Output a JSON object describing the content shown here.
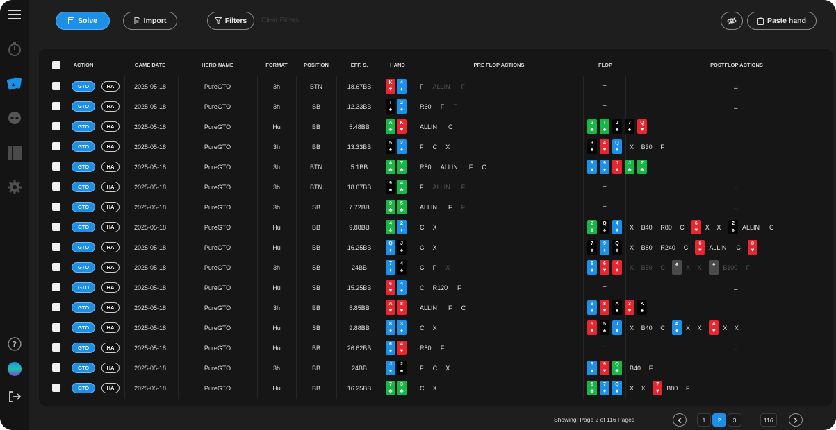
{
  "toolbar": {
    "solve_label": "Solve",
    "import_label": "Import",
    "filters_label": "Filters",
    "clear_filters_label": "Clear Filters",
    "paste_hand_label": "Paste hand"
  },
  "table": {
    "columns": [
      "ACTION",
      "GAME DATE",
      "HERO NAME",
      "FORMAT",
      "POSITION",
      "EFF. S.",
      "HAND",
      "PRE FLOP ACTIONS",
      "FLOP",
      "POSTFLOP ACTIONS"
    ],
    "gto_label": "GTO",
    "ha_label": "HA",
    "rows": [
      {
        "date": "2025-05-18",
        "hero": "PureGTO",
        "format": "3h",
        "position": "BTN",
        "eff": "18.67BB",
        "hand": [
          {
            "r": "K",
            "s": "♥",
            "c": "red"
          },
          {
            "r": "4",
            "s": "♦",
            "c": "blue"
          }
        ],
        "pre": [
          {
            "t": "F"
          },
          {
            "t": "ALLIN",
            "dim": true
          },
          {
            "t": "F",
            "dim": true
          }
        ],
        "flop": [],
        "post": []
      },
      {
        "date": "2025-05-18",
        "hero": "PureGTO",
        "format": "3h",
        "position": "SB",
        "eff": "12.33BB",
        "hand": [
          {
            "r": "T",
            "s": "♠",
            "c": "black"
          },
          {
            "r": "2",
            "s": "♦",
            "c": "blue"
          }
        ],
        "pre": [
          {
            "t": "R60"
          },
          {
            "t": "F"
          },
          {
            "t": "F",
            "dim": true
          }
        ],
        "flop": [],
        "post": []
      },
      {
        "date": "2025-05-18",
        "hero": "PureGTO",
        "format": "Hu",
        "position": "BB",
        "eff": "5.48BB",
        "hand": [
          {
            "r": "A",
            "s": "♣",
            "c": "green"
          },
          {
            "r": "K",
            "s": "♥",
            "c": "red"
          }
        ],
        "pre": [
          {
            "t": "ALLIN"
          },
          {
            "t": "C"
          }
        ],
        "flop": [
          {
            "r": "2",
            "s": "♣",
            "c": "green"
          },
          {
            "r": "T",
            "s": "♣",
            "c": "green"
          },
          {
            "r": "J",
            "s": "♠",
            "c": "black"
          },
          {
            "r": "7",
            "s": "♠",
            "c": "black"
          },
          {
            "r": "Q",
            "s": "♥",
            "c": "red"
          }
        ],
        "post": []
      },
      {
        "date": "2025-05-18",
        "hero": "PureGTO",
        "format": "3h",
        "position": "BB",
        "eff": "13.33BB",
        "hand": [
          {
            "r": "5",
            "s": "♠",
            "c": "black"
          },
          {
            "r": "2",
            "s": "♦",
            "c": "blue"
          }
        ],
        "pre": [
          {
            "t": "F"
          },
          {
            "t": "C"
          },
          {
            "t": "X"
          }
        ],
        "flop": [
          {
            "r": "3",
            "s": "♠",
            "c": "black"
          },
          {
            "r": "4",
            "s": "♥",
            "c": "red"
          },
          {
            "r": "Q",
            "s": "♦",
            "c": "blue"
          }
        ],
        "post": [
          {
            "t": "X"
          },
          {
            "t": "B30"
          },
          {
            "t": "F"
          }
        ]
      },
      {
        "date": "2025-05-18",
        "hero": "PureGTO",
        "format": "3h",
        "position": "BTN",
        "eff": "5.1BB",
        "hand": [
          {
            "r": "A",
            "s": "♣",
            "c": "green"
          },
          {
            "r": "T",
            "s": "♣",
            "c": "green"
          }
        ],
        "pre": [
          {
            "t": "R80"
          },
          {
            "t": "ALLIN"
          },
          {
            "t": "F"
          },
          {
            "t": "C"
          }
        ],
        "flop": [
          {
            "r": "3",
            "s": "♦",
            "c": "blue"
          },
          {
            "r": "9",
            "s": "♦",
            "c": "blue"
          },
          {
            "r": "J",
            "s": "♥",
            "c": "red"
          },
          {
            "r": "J",
            "s": "♣",
            "c": "green"
          },
          {
            "r": "7",
            "s": "♣",
            "c": "green"
          }
        ],
        "post": []
      },
      {
        "date": "2025-05-18",
        "hero": "PureGTO",
        "format": "3h",
        "position": "BTN",
        "eff": "18.67BB",
        "hand": [
          {
            "r": "9",
            "s": "♠",
            "c": "black"
          },
          {
            "r": "4",
            "s": "♣",
            "c": "green"
          }
        ],
        "pre": [
          {
            "t": "F"
          },
          {
            "t": "ALLIN",
            "dim": true
          },
          {
            "t": "F",
            "dim": true
          }
        ],
        "flop": [],
        "post": []
      },
      {
        "date": "2025-05-18",
        "hero": "PureGTO",
        "format": "3h",
        "position": "SB",
        "eff": "7.72BB",
        "hand": [
          {
            "r": "9",
            "s": "♣",
            "c": "green"
          },
          {
            "r": "5",
            "s": "♣",
            "c": "green"
          }
        ],
        "pre": [
          {
            "t": "ALLIN"
          },
          {
            "t": "F"
          },
          {
            "t": "F",
            "dim": true
          }
        ],
        "flop": [],
        "post": []
      },
      {
        "date": "2025-05-18",
        "hero": "PureGTO",
        "format": "Hu",
        "position": "BB",
        "eff": "9.88BB",
        "hand": [
          {
            "r": "4",
            "s": "♣",
            "c": "green"
          },
          {
            "r": "2",
            "s": "♦",
            "c": "blue"
          }
        ],
        "pre": [
          {
            "t": "C"
          },
          {
            "t": "X"
          }
        ],
        "flop": [
          {
            "r": "2",
            "s": "♣",
            "c": "green"
          },
          {
            "r": "Q",
            "s": "♠",
            "c": "black"
          },
          {
            "r": "4",
            "s": "♦",
            "c": "blue"
          }
        ],
        "post": [
          {
            "t": "X"
          },
          {
            "t": "B40"
          },
          {
            "t": "R80"
          },
          {
            "t": "C"
          },
          {
            "card": {
              "r": "6",
              "s": "♥",
              "c": "red"
            }
          },
          {
            "t": "X"
          },
          {
            "t": "X"
          },
          {
            "card": {
              "r": "2",
              "s": "♠",
              "c": "black"
            }
          },
          {
            "t": "ALLIN"
          },
          {
            "t": "C"
          }
        ]
      },
      {
        "date": "2025-05-18",
        "hero": "PureGTO",
        "format": "Hu",
        "position": "BB",
        "eff": "16.25BB",
        "hand": [
          {
            "r": "Q",
            "s": "♦",
            "c": "blue"
          },
          {
            "r": "J",
            "s": "♠",
            "c": "black"
          }
        ],
        "pre": [
          {
            "t": "C"
          },
          {
            "t": "X"
          }
        ],
        "flop": [
          {
            "r": "7",
            "s": "♠",
            "c": "black"
          },
          {
            "r": "9",
            "s": "♦",
            "c": "blue"
          },
          {
            "r": "Q",
            "s": "♠",
            "c": "black"
          }
        ],
        "post": [
          {
            "t": "X"
          },
          {
            "t": "B80"
          },
          {
            "t": "R240"
          },
          {
            "t": "C"
          },
          {
            "card": {
              "r": "6",
              "s": "♥",
              "c": "red"
            }
          },
          {
            "t": "ALLIN"
          },
          {
            "t": "C"
          },
          {
            "card": {
              "r": "8",
              "s": "♥",
              "c": "red"
            }
          }
        ]
      },
      {
        "date": "2025-05-18",
        "hero": "PureGTO",
        "format": "3h",
        "position": "SB",
        "eff": "24BB",
        "hand": [
          {
            "r": "7",
            "s": "♦",
            "c": "blue"
          },
          {
            "r": "4",
            "s": "♠",
            "c": "black"
          }
        ],
        "pre": [
          {
            "t": "C"
          },
          {
            "t": "F"
          },
          {
            "t": "X",
            "dim": true
          }
        ],
        "flop": [
          {
            "r": "6",
            "s": "♦",
            "c": "blue"
          },
          {
            "r": "6",
            "s": "♥",
            "c": "red"
          },
          {
            "r": "K",
            "s": "♥",
            "c": "red"
          }
        ],
        "post": [
          {
            "t": "X",
            "dim": true
          },
          {
            "t": "B50",
            "dim": true
          },
          {
            "t": "C",
            "dim": true
          },
          {
            "card": {
              "r": "",
              "s": "♠",
              "c": "gray"
            }
          },
          {
            "t": "X",
            "dim": true
          },
          {
            "t": "X",
            "dim": true
          },
          {
            "card": {
              "r": "",
              "s": "♠",
              "c": "gray"
            }
          },
          {
            "t": "B100",
            "dim": true
          },
          {
            "t": "F",
            "dim": true
          }
        ]
      },
      {
        "date": "2025-05-18",
        "hero": "PureGTO",
        "format": "Hu",
        "position": "SB",
        "eff": "15.25BB",
        "hand": [
          {
            "r": "6",
            "s": "♥",
            "c": "red"
          },
          {
            "r": "4",
            "s": "♦",
            "c": "blue"
          }
        ],
        "pre": [
          {
            "t": "C"
          },
          {
            "t": "R120"
          },
          {
            "t": "F"
          }
        ],
        "flop": [],
        "post": []
      },
      {
        "date": "2025-05-18",
        "hero": "PureGTO",
        "format": "3h",
        "position": "BB",
        "eff": "5.85BB",
        "hand": [
          {
            "r": "A",
            "s": "♥",
            "c": "red"
          },
          {
            "r": "8",
            "s": "♥",
            "c": "red"
          }
        ],
        "pre": [
          {
            "t": "ALLIN"
          },
          {
            "t": "F"
          },
          {
            "t": "C"
          }
        ],
        "flop": [
          {
            "r": "9",
            "s": "♦",
            "c": "blue"
          },
          {
            "r": "8",
            "s": "♥",
            "c": "red"
          },
          {
            "r": "A",
            "s": "♠",
            "c": "black"
          },
          {
            "r": "3",
            "s": "♥",
            "c": "red"
          },
          {
            "r": "K",
            "s": "♠",
            "c": "black"
          }
        ],
        "post": []
      },
      {
        "date": "2025-05-18",
        "hero": "PureGTO",
        "format": "Hu",
        "position": "SB",
        "eff": "9.88BB",
        "hand": [
          {
            "r": "8",
            "s": "♦",
            "c": "blue"
          },
          {
            "r": "3",
            "s": "♦",
            "c": "blue"
          }
        ],
        "pre": [
          {
            "t": "C"
          },
          {
            "t": "X"
          }
        ],
        "flop": [
          {
            "r": "5",
            "s": "♥",
            "c": "red"
          },
          {
            "r": "5",
            "s": "♠",
            "c": "black"
          },
          {
            "r": "J",
            "s": "♦",
            "c": "blue"
          }
        ],
        "post": [
          {
            "t": "X"
          },
          {
            "t": "B40"
          },
          {
            "t": "C"
          },
          {
            "card": {
              "r": "A",
              "s": "♦",
              "c": "blue"
            }
          },
          {
            "t": "X"
          },
          {
            "t": "X"
          },
          {
            "card": {
              "r": "4",
              "s": "♥",
              "c": "red"
            }
          },
          {
            "t": "X"
          },
          {
            "t": "X"
          }
        ]
      },
      {
        "date": "2025-05-18",
        "hero": "PureGTO",
        "format": "Hu",
        "position": "BB",
        "eff": "26.62BB",
        "hand": [
          {
            "r": "6",
            "s": "♦",
            "c": "blue"
          },
          {
            "r": "4",
            "s": "♥",
            "c": "red"
          }
        ],
        "pre": [
          {
            "t": "R80"
          },
          {
            "t": "F"
          }
        ],
        "flop": [],
        "post": []
      },
      {
        "date": "2025-05-18",
        "hero": "PureGTO",
        "format": "3h",
        "position": "BB",
        "eff": "24BB",
        "hand": [
          {
            "r": "J",
            "s": "♦",
            "c": "blue"
          },
          {
            "r": "2",
            "s": "♠",
            "c": "black"
          }
        ],
        "pre": [
          {
            "t": "F"
          },
          {
            "t": "C"
          },
          {
            "t": "X"
          }
        ],
        "flop": [
          {
            "r": "5",
            "s": "♦",
            "c": "blue"
          },
          {
            "r": "9",
            "s": "♥",
            "c": "red"
          },
          {
            "r": "Q",
            "s": "♣",
            "c": "green"
          }
        ],
        "post": [
          {
            "t": "B40"
          },
          {
            "t": "F"
          }
        ]
      },
      {
        "date": "2025-05-18",
        "hero": "PureGTO",
        "format": "Hu",
        "position": "BB",
        "eff": "16.25BB",
        "hand": [
          {
            "r": "7",
            "s": "♣",
            "c": "green"
          },
          {
            "r": "3",
            "s": "♣",
            "c": "green"
          }
        ],
        "pre": [
          {
            "t": "C"
          },
          {
            "t": "X"
          }
        ],
        "flop": [
          {
            "r": "5",
            "s": "♣",
            "c": "green"
          },
          {
            "r": "7",
            "s": "♦",
            "c": "blue"
          },
          {
            "r": "Q",
            "s": "♦",
            "c": "blue"
          }
        ],
        "post": [
          {
            "t": "X"
          },
          {
            "t": "X"
          },
          {
            "card": {
              "r": "7",
              "s": "♥",
              "c": "red"
            }
          },
          {
            "t": "B80"
          },
          {
            "t": "F"
          }
        ]
      }
    ]
  },
  "pagination": {
    "showing_text": "Showing: Page 2 of 116 Pages",
    "pages": [
      "1",
      "2",
      "3",
      "...",
      "116"
    ],
    "current": "2"
  },
  "colors": {
    "accent": "#1e8fe6",
    "card_red": "#e8262f",
    "card_blue": "#1e8fe6",
    "card_green": "#18b547",
    "card_black": "#050505"
  },
  "sidebar_icons": [
    "menu-icon",
    "timer-icon",
    "cards-icon",
    "robot-icon",
    "grid-icon",
    "gear-icon",
    "help-icon",
    "avatar",
    "logout-icon"
  ]
}
